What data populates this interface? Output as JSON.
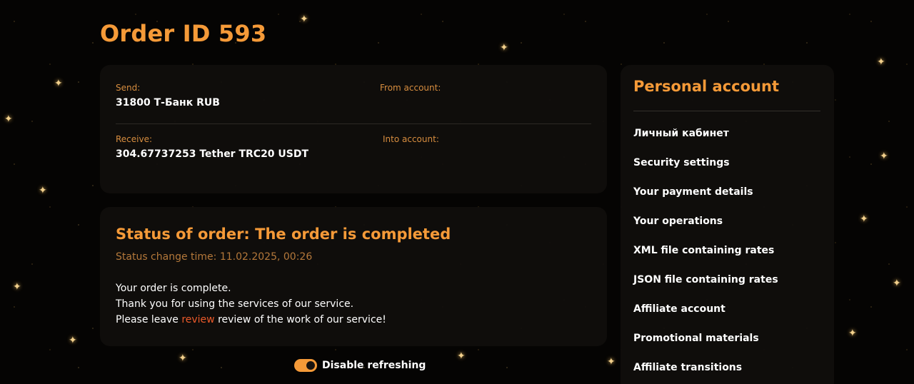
{
  "order": {
    "title": "Order ID 593",
    "send_label": "Send:",
    "send_value": "31800 Т-Банк RUB",
    "from_account_label": "From account:",
    "receive_label": "Receive:",
    "receive_value": "304.67737253 Tether TRC20 USDT",
    "into_account_label": "Into account:"
  },
  "status": {
    "title": "Status of order: The order is completed",
    "time": "Status change time: 11.02.2025, 00:26",
    "line1": "Your order is complete.",
    "line2": "Thank you for using the services of our service.",
    "line3_prefix": "Please leave ",
    "line3_link": "review",
    "line3_suffix": " review of the work of our service!"
  },
  "refresh": {
    "toggle_on": true,
    "label": "Disable refreshing"
  },
  "sidebar": {
    "title": "Personal account",
    "items": [
      {
        "label": "Личный кабинет"
      },
      {
        "label": "Security settings"
      },
      {
        "label": "Your payment details"
      },
      {
        "label": "Your operations"
      },
      {
        "label": "XML file containing rates"
      },
      {
        "label": "JSON file containing rates"
      },
      {
        "label": "Affiliate account"
      },
      {
        "label": "Promotional materials"
      },
      {
        "label": "Affiliate transitions"
      }
    ]
  },
  "colors": {
    "accent": "#f59a38",
    "link": "#ec5a2a",
    "background": "#050403",
    "card": "#100e0c"
  }
}
